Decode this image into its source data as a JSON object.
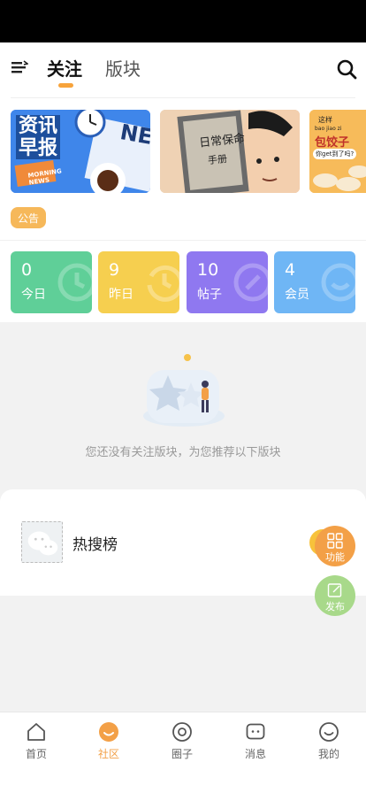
{
  "header": {
    "tabs": [
      {
        "label": "关注",
        "active": true
      },
      {
        "label": "版块",
        "active": false
      }
    ],
    "icons": {
      "menu": "menu-icon",
      "search": "search-icon"
    }
  },
  "banners": [
    {
      "lines": [
        "资讯",
        "早报"
      ],
      "tag_lines": [
        "MORNING",
        "NEWS"
      ],
      "corner_text": "NE"
    },
    {
      "book_title": "日常保命",
      "book_subtitle": "手册"
    },
    {
      "top_text": "这样",
      "pinyin": "bao jiao zi",
      "title": "包饺子",
      "bubble": "你get到了吗?"
    }
  ],
  "notice": {
    "label": "公告"
  },
  "stats": [
    {
      "value": "0",
      "label": "今日",
      "color": "#5fcf98"
    },
    {
      "value": "9",
      "label": "昨日",
      "color": "#f6cf4f"
    },
    {
      "value": "10",
      "label": "帖子",
      "color": "#8f78f0"
    },
    {
      "value": "4",
      "label": "会员",
      "color": "#6fb6f5"
    }
  ],
  "empty_state": {
    "message": "您还没有关注版块，为您推荐以下版块"
  },
  "recommendations": [
    {
      "title": "热搜榜"
    }
  ],
  "fabs": [
    {
      "label": "功能",
      "icon": "grid-icon"
    },
    {
      "label": "发布",
      "icon": "edit-icon"
    }
  ],
  "bottom_nav": [
    {
      "label": "首页",
      "icon": "home-icon",
      "active": false
    },
    {
      "label": "社区",
      "icon": "community-icon",
      "active": true
    },
    {
      "label": "圈子",
      "icon": "circle-icon",
      "active": false
    },
    {
      "label": "消息",
      "icon": "message-icon",
      "active": false
    },
    {
      "label": "我的",
      "icon": "profile-icon",
      "active": false
    }
  ],
  "colors": {
    "accent": "#f3a047",
    "banner_blue": "#3a7be0"
  }
}
